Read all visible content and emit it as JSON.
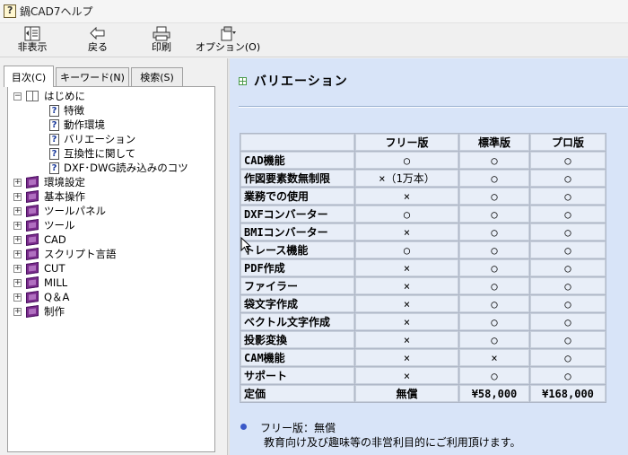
{
  "window": {
    "title": "鍋CAD7ヘルプ"
  },
  "toolbar": {
    "hide_label": "非表示",
    "back_label": "戻る",
    "print_label": "印刷",
    "options_label": "オプション(O)"
  },
  "tabs": {
    "contents": "目次(C)",
    "keyword": "キーワード(N)",
    "search": "検索(S)"
  },
  "tree": {
    "root": "はじめに",
    "children": [
      "特徴",
      "動作環境",
      "バリエーション",
      "互換性に関して",
      "DXF･DWG読み込みのコツ"
    ],
    "sections": [
      "環境設定",
      "基本操作",
      "ツールパネル",
      "ツール",
      "CAD",
      "スクリプト言語",
      "CUT",
      "MILL",
      "Q＆A",
      "制作"
    ]
  },
  "content": {
    "heading": "バリエーション",
    "table": {
      "headers": [
        "",
        "フリー版",
        "標準版",
        "プロ版"
      ],
      "rows": [
        [
          "CAD機能",
          "○",
          "○",
          "○"
        ],
        [
          "作図要素数無制限",
          "×（1万本）",
          "○",
          "○"
        ],
        [
          "業務での使用",
          "×",
          "○",
          "○"
        ],
        [
          "DXFコンバーター",
          "○",
          "○",
          "○"
        ],
        [
          "BMIコンバーター",
          "×",
          "○",
          "○"
        ],
        [
          "トレース機能",
          "○",
          "○",
          "○"
        ],
        [
          "PDF作成",
          "×",
          "○",
          "○"
        ],
        [
          "ファイラー",
          "×",
          "○",
          "○"
        ],
        [
          "袋文字作成",
          "×",
          "○",
          "○"
        ],
        [
          "ベクトル文字作成",
          "×",
          "○",
          "○"
        ],
        [
          "投影変換",
          "×",
          "○",
          "○"
        ],
        [
          "CAM機能",
          "×",
          "×",
          "○"
        ],
        [
          "サポート",
          "×",
          "○",
          "○"
        ],
        [
          "定価",
          "無償",
          "¥58,000",
          "¥168,000"
        ]
      ]
    },
    "note_line1": "フリー版：無償",
    "note_line2": "教育向け及び趣味等の非営利目的にご利用頂けます。"
  }
}
